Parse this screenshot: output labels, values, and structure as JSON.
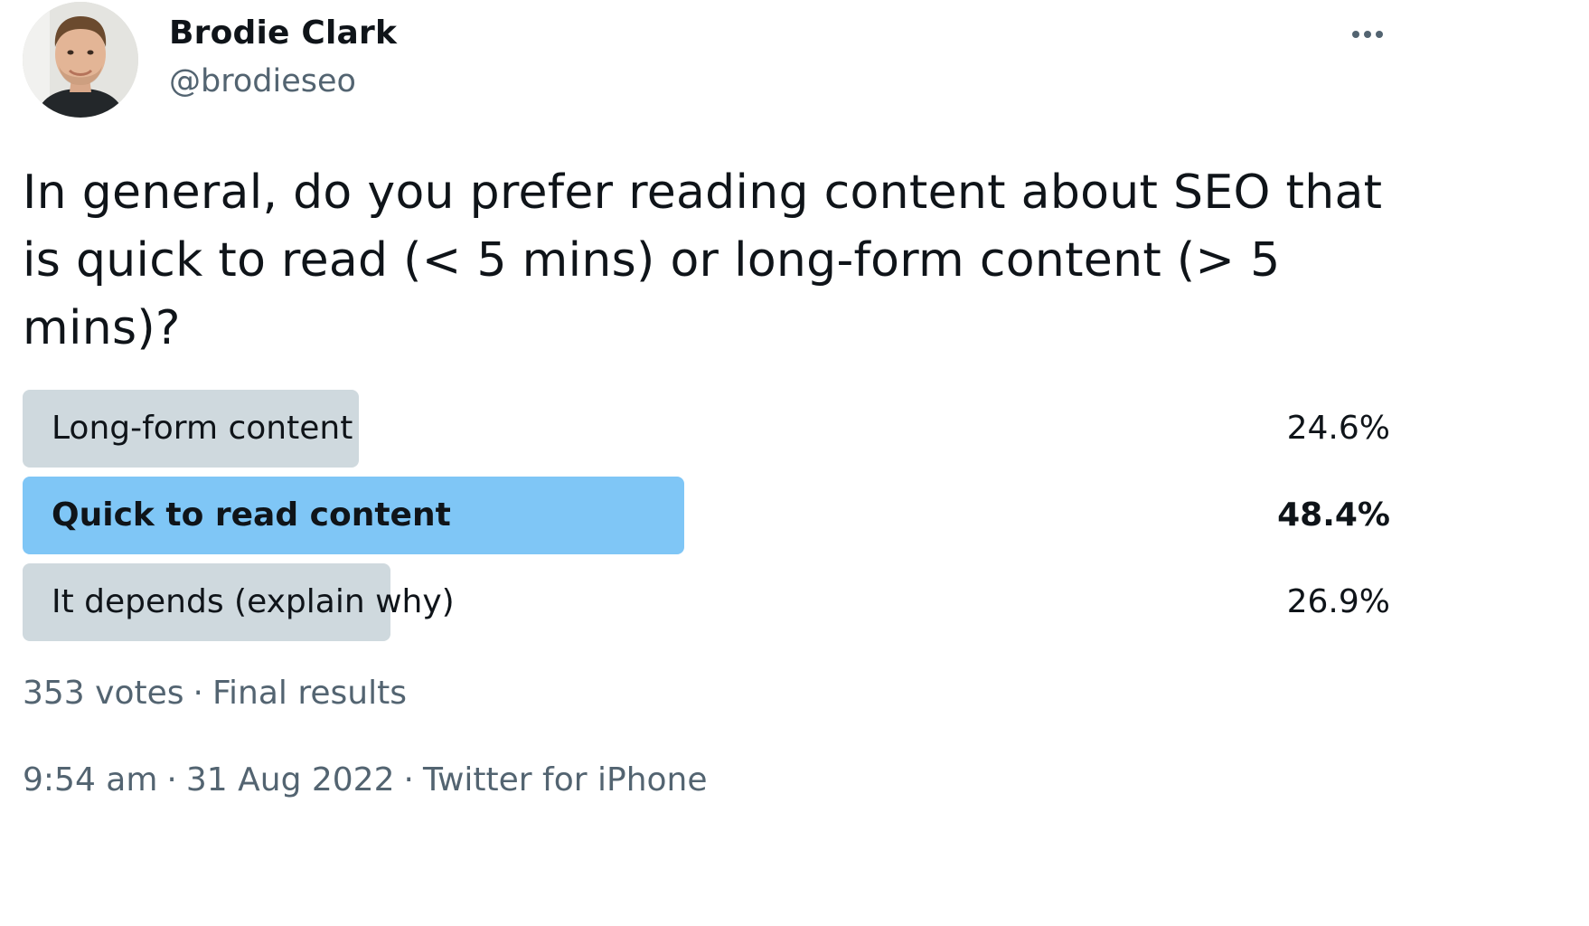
{
  "author": {
    "name": "Brodie Clark",
    "handle": "@brodieseo",
    "avatar_icon": "profile-photo"
  },
  "more_icon": "more-horizontal-icon",
  "tweet_text": "In general, do you prefer reading content about SEO that is quick to read (< 5 mins) or long-form content (> 5 mins)?",
  "poll": {
    "options": [
      {
        "label": "Long-form content",
        "percent_text": "24.6%",
        "percent": 24.6,
        "winner": false
      },
      {
        "label": "Quick to read content",
        "percent_text": "48.4%",
        "percent": 48.4,
        "winner": true
      },
      {
        "label": "It depends (explain why)",
        "percent_text": "26.9%",
        "percent": 26.9,
        "winner": false
      }
    ],
    "votes": "353 votes",
    "separator": "·",
    "status": "Final results"
  },
  "meta": {
    "time": "9:54 am",
    "date": "31 Aug 2022",
    "source": "Twitter for iPhone",
    "separator": "·"
  },
  "colors": {
    "winner_fill": "#7fc6f6",
    "loser_fill": "#cfd9de",
    "secondary_text": "#536471",
    "primary_text": "#0f1419"
  }
}
